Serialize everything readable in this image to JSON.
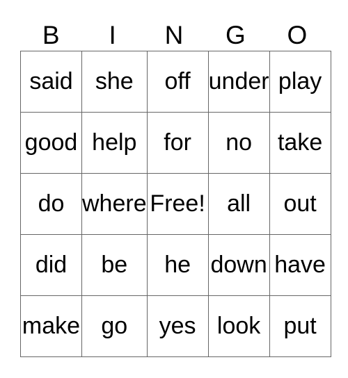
{
  "header": [
    "B",
    "I",
    "N",
    "G",
    "O"
  ],
  "rows": [
    [
      "said",
      "she",
      "off",
      "under",
      "play"
    ],
    [
      "good",
      "help",
      "for",
      "no",
      "take"
    ],
    [
      "do",
      "where",
      "Free!",
      "all",
      "out"
    ],
    [
      "did",
      "be",
      "he",
      "down",
      "have"
    ],
    [
      "make",
      "go",
      "yes",
      "look",
      "put"
    ]
  ]
}
